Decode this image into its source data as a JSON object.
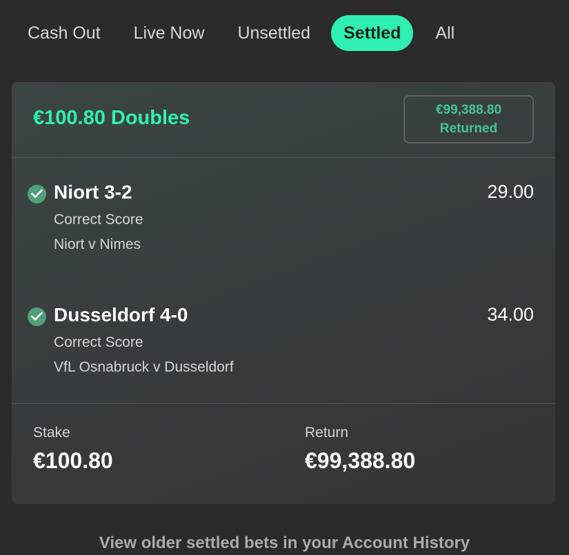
{
  "tabs": [
    {
      "label": "Cash Out",
      "active": false
    },
    {
      "label": "Live Now",
      "active": false
    },
    {
      "label": "Unsettled",
      "active": false
    },
    {
      "label": "Settled",
      "active": true
    },
    {
      "label": "All",
      "active": false
    }
  ],
  "bet": {
    "title": "€100.80 Doubles",
    "returned_amount": "€99,388.80",
    "returned_label": "Returned",
    "selections": [
      {
        "name": "Niort 3-2",
        "odds": "29.00",
        "market": "Correct Score",
        "event": "Niort v Nimes",
        "status_icon": "check-circle-icon"
      },
      {
        "name": "Dusseldorf 4-0",
        "odds": "34.00",
        "market": "Correct Score",
        "event": "VfL Osnabruck v Dusseldorf",
        "status_icon": "check-circle-icon"
      }
    ],
    "stake_label": "Stake",
    "stake_value": "€100.80",
    "return_label": "Return",
    "return_value": "€99,388.80"
  },
  "footer": {
    "history_link": "View older settled bets in your Account History"
  },
  "colors": {
    "accent": "#2ff0b0",
    "win_check": "#52a07b",
    "returned_text": "#45c595",
    "background": "#2b2b2b"
  }
}
